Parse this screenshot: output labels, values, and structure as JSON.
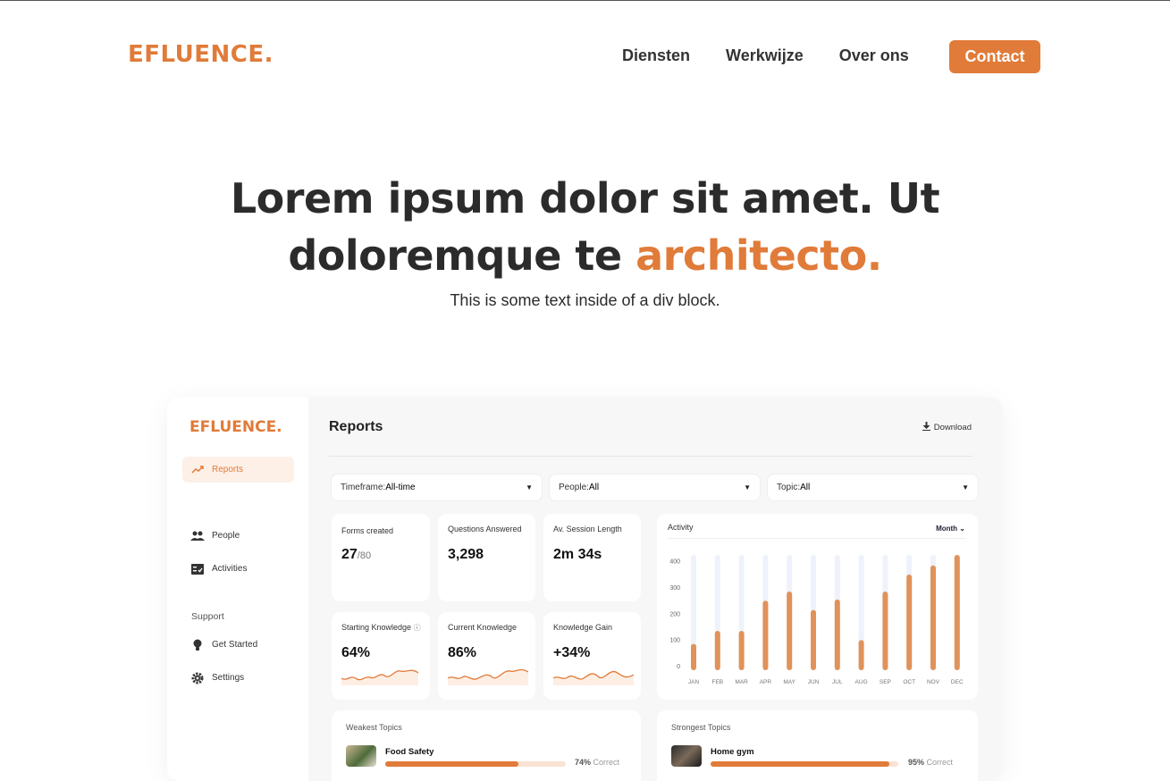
{
  "brand": {
    "logo": "EFLUENCE.",
    "accent": "#e07b39"
  },
  "nav": {
    "items": [
      "Diensten",
      "Werkwijze",
      "Over ons"
    ],
    "cta": "Contact"
  },
  "hero": {
    "line1": "Lorem ipsum dolor sit amet. Ut",
    "line2_plain": "doloremque te ",
    "line2_accent": "architecto.",
    "sub": "This is some text inside of a div block."
  },
  "dashboard": {
    "logo": "EFLUENCE.",
    "sidebar": {
      "reports": "Reports",
      "people": "People",
      "activities": "Activities",
      "support_heading": "Support",
      "get_started": "Get Started",
      "settings": "Settings"
    },
    "title": "Reports",
    "download": "Download",
    "filters": [
      {
        "label": "Timeframe: ",
        "value": "All-time"
      },
      {
        "label": "People: ",
        "value": "All"
      },
      {
        "label": "Topic: ",
        "value": "All"
      }
    ],
    "stats": {
      "forms": {
        "label": "Forms created",
        "value": "27",
        "total": "/80"
      },
      "questions": {
        "label": "Questions Answered",
        "value": "3,298"
      },
      "session": {
        "label": "Av. Session Length",
        "value": "2m 34s"
      },
      "starting": {
        "label": "Starting Knowledge",
        "value": "64%"
      },
      "current": {
        "label": "Current Knowledge",
        "value": "86%"
      },
      "gain": {
        "label": "Knowledge Gain",
        "value": "+34%"
      }
    },
    "activity": {
      "label": "Activity",
      "period": "Month"
    },
    "topics": {
      "weakest": {
        "label": "Weakest Topics",
        "name": "Food Safety",
        "percent": "74%",
        "suffix": " Correct",
        "fraction": 0.74
      },
      "strongest": {
        "label": "Strongest Topics",
        "name": "Home gym",
        "percent": "95%",
        "suffix": " Correct",
        "fraction": 0.95
      }
    }
  },
  "chart_data": {
    "type": "bar",
    "title": "Activity",
    "categories": [
      "JAN",
      "FEB",
      "MAR",
      "APR",
      "MAY",
      "JUN",
      "JUL",
      "AUG",
      "SEP",
      "OCT",
      "NOV",
      "DEC"
    ],
    "values": [
      100,
      150,
      150,
      265,
      300,
      230,
      270,
      115,
      300,
      365,
      400,
      440
    ],
    "yticks": [
      0,
      100,
      200,
      300,
      400
    ],
    "ylim": [
      0,
      440
    ],
    "color": "#e0925a",
    "track_color": "#eef2fb"
  }
}
